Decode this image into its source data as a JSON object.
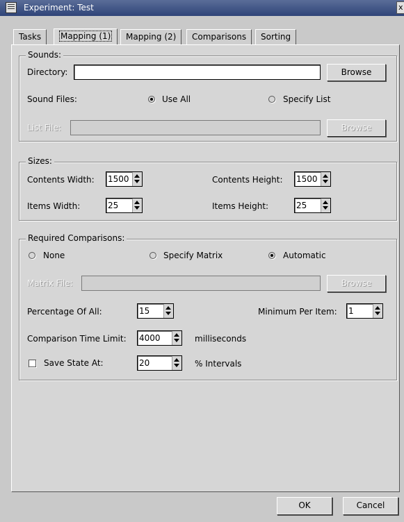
{
  "window": {
    "title": "Experiment: Test",
    "close_glyph": "x"
  },
  "tabs": [
    {
      "label": "Tasks"
    },
    {
      "label": "Mapping (1)"
    },
    {
      "label": "Mapping (2)"
    },
    {
      "label": "Comparisons"
    },
    {
      "label": "Sorting"
    }
  ],
  "active_tab": "Mapping (1)",
  "sounds": {
    "title": "Sounds:",
    "directory_label": "Directory:",
    "directory_value": "",
    "browse_label": "Browse",
    "sound_files_label": "Sound Files:",
    "use_all_label": "Use All",
    "specify_list_label": "Specify List",
    "selected": "Use All",
    "list_file_label": "List File:",
    "list_file_value": "",
    "list_browse_label": "Browse"
  },
  "sizes": {
    "title": "Sizes:",
    "contents_width_label": "Contents Width:",
    "contents_width_value": "1500",
    "contents_height_label": "Contents Height:",
    "contents_height_value": "1500",
    "items_width_label": "Items Width:",
    "items_width_value": "25",
    "items_height_label": "Items Height:",
    "items_height_value": "25"
  },
  "comparisons": {
    "title": "Required Comparisons:",
    "none_label": "None",
    "specify_matrix_label": "Specify Matrix",
    "automatic_label": "Automatic",
    "selected": "Automatic",
    "matrix_file_label": "Matrix File:",
    "matrix_file_value": "",
    "matrix_browse_label": "Browse",
    "percentage_label": "Percentage Of All:",
    "percentage_value": "15",
    "min_per_item_label": "Minimum Per Item:",
    "min_per_item_value": "1",
    "time_limit_label": "Comparison Time Limit:",
    "time_limit_value": "4000",
    "time_limit_unit": "milliseconds",
    "save_state_label": "Save State At:",
    "save_state_checked": false,
    "save_state_value": "20",
    "save_state_unit": "% Intervals"
  },
  "footer": {
    "ok_label": "OK",
    "cancel_label": "Cancel"
  }
}
